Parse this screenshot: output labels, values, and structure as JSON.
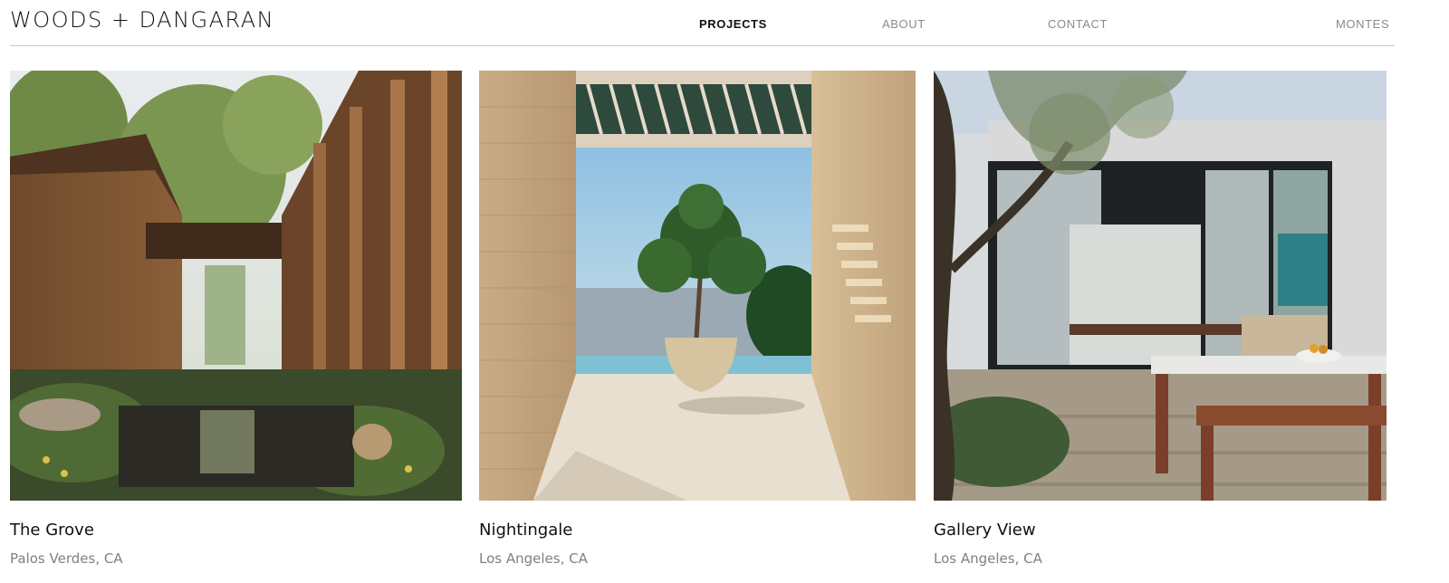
{
  "brand": {
    "logo_text": "WOODS + DANGARAN"
  },
  "nav": {
    "items": [
      {
        "label": "PROJECTS",
        "active": true
      },
      {
        "label": "ABOUT",
        "active": false
      },
      {
        "label": "CONTACT",
        "active": false
      },
      {
        "label": "MONTES",
        "active": false
      }
    ]
  },
  "projects": [
    {
      "title": "The Grove",
      "location": "Palos Verdes, CA"
    },
    {
      "title": "Nightingale",
      "location": "Los Angeles, CA"
    },
    {
      "title": "Gallery View",
      "location": "Los Angeles, CA"
    }
  ],
  "colors": {
    "text_primary": "#111111",
    "text_muted": "#808080",
    "nav_inactive": "#8a8a8a",
    "divider": "#c9c9c9"
  }
}
